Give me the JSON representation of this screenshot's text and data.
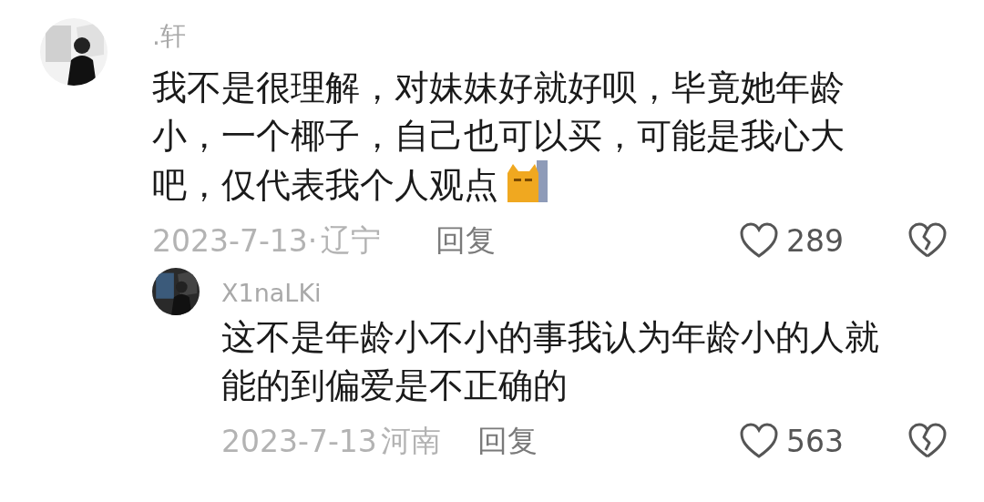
{
  "comments": [
    {
      "user": ".轩",
      "text": "我不是很理解，对妹妹好就好呗，毕竟她年龄小，一个椰子，自己也可以买，可能是我心大吧，仅代表我个人观点",
      "emoji": true,
      "date": "2023-7-13·",
      "location": "辽宁",
      "reply": "回复",
      "likes": "289",
      "replies": [
        {
          "user": "X1naLKi",
          "text": "这不是年龄小不小的事我认为年龄小的人就能的到偏爱是不正确的",
          "emoji": false,
          "date": "2023-7-13",
          "location": "河南",
          "reply": "回复",
          "likes": "563"
        }
      ]
    }
  ]
}
